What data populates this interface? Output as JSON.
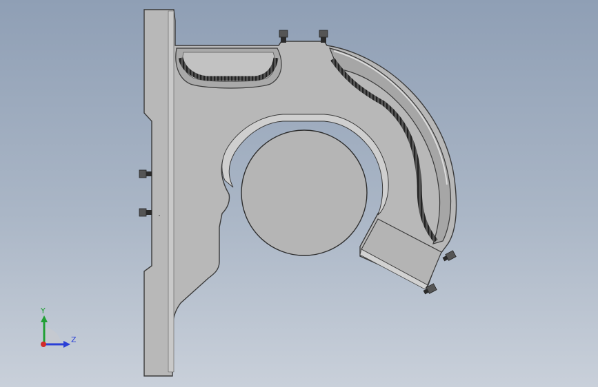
{
  "viewport": {
    "background_top": "#8f9fb5",
    "background_bottom": "#c9d0da"
  },
  "part": {
    "body_color": "#b7b7b7",
    "edge_color": "#3a3a3a",
    "chamfer_color": "#d8d8d8",
    "shadow_color": "#7e7e7e",
    "spring_color": "#3c3c3c",
    "bolt_color": "#2a2a2a"
  },
  "triad": {
    "y_label": "Y",
    "z_label": "Z",
    "y_color": "#21a035",
    "z_color": "#2a3fd6",
    "x_color": "#d22b2b"
  }
}
